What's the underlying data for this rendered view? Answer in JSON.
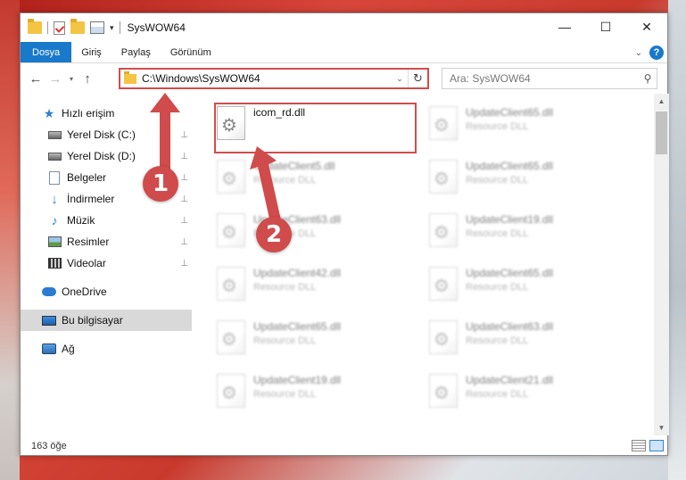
{
  "window": {
    "title": "SysWOW64"
  },
  "ribbon": {
    "tabs": [
      "Dosya",
      "Giriş",
      "Paylaş",
      "Görünüm"
    ]
  },
  "address": {
    "path": "C:\\Windows\\SysWOW64"
  },
  "search": {
    "placeholder": "Ara: SysWOW64"
  },
  "nav": {
    "quick_access": "Hızlı erişim",
    "items": [
      "Yerel Disk (C:)",
      "Yerel Disk (D:)",
      "Belgeler",
      "İndirmeler",
      "Müzik",
      "Resimler",
      "Videolar"
    ],
    "onedrive": "OneDrive",
    "this_pc": "Bu bilgisayar",
    "network": "Ağ"
  },
  "files": [
    {
      "name": "icom_rd.dll",
      "type": ""
    },
    {
      "name": "UpdateClient65.dll",
      "type": "Resource DLL"
    },
    {
      "name": "UpdateClient5.dll",
      "type": "Resource DLL"
    },
    {
      "name": "UpdateClient65.dll",
      "type": "Resource DLL"
    },
    {
      "name": "UpdateClient63.dll",
      "type": "Resource DLL"
    },
    {
      "name": "UpdateClient19.dll",
      "type": "Resource DLL"
    },
    {
      "name": "UpdateClient42.dll",
      "type": "Resource DLL"
    },
    {
      "name": "UpdateClient65.dll",
      "type": "Resource DLL"
    },
    {
      "name": "UpdateClient65.dll",
      "type": "Resource DLL"
    },
    {
      "name": "UpdateClient63.dll",
      "type": "Resource DLL"
    },
    {
      "name": "UpdateClient19.dll",
      "type": "Resource DLL"
    },
    {
      "name": "UpdateClient21.dll",
      "type": "Resource DLL"
    }
  ],
  "status": {
    "count": "163 öğe"
  },
  "annotations": {
    "step1": "1",
    "step2": "2"
  },
  "colors": {
    "accent": "#1979ca",
    "highlight": "#d24c4c"
  }
}
